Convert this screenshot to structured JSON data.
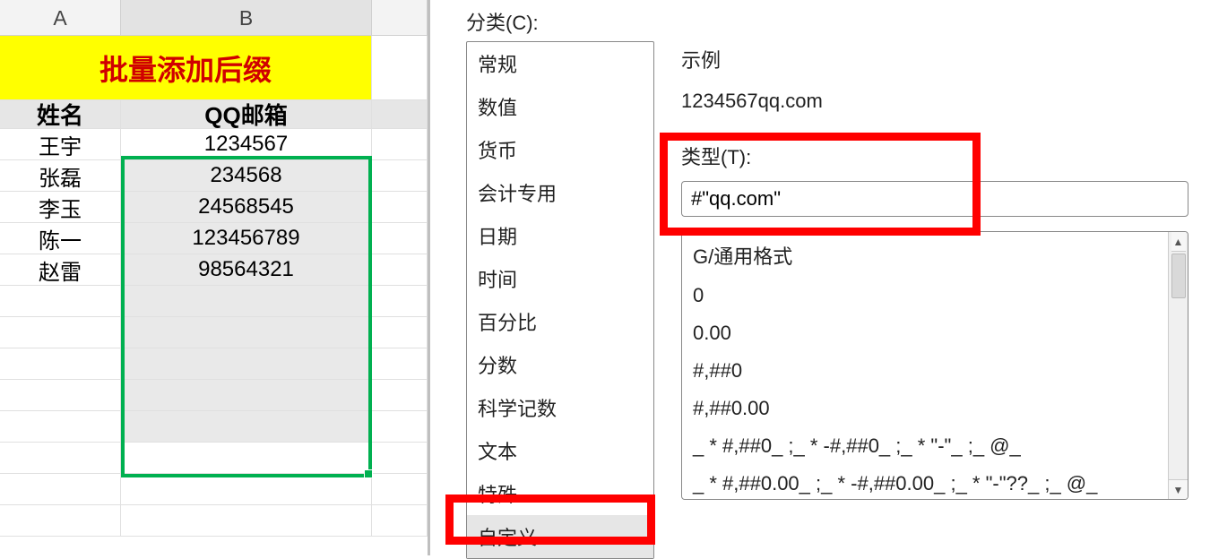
{
  "sheet": {
    "columns": {
      "A": "A",
      "B": "B"
    },
    "title": "批量添加后缀",
    "headers": {
      "name": "姓名",
      "email": "QQ邮箱"
    },
    "rows": [
      {
        "name": "王宇",
        "qq": "1234567"
      },
      {
        "name": "张磊",
        "qq": "234568"
      },
      {
        "name": "李玉",
        "qq": "24568545"
      },
      {
        "name": "陈一",
        "qq": "123456789"
      },
      {
        "name": "赵雷",
        "qq": "98564321"
      }
    ]
  },
  "dialog": {
    "category_label": "分类(C):",
    "categories": [
      "常规",
      "数值",
      "货币",
      "会计专用",
      "日期",
      "时间",
      "百分比",
      "分数",
      "科学记数",
      "文本",
      "特殊",
      "自定义"
    ],
    "selected_category_index": 11,
    "sample_label": "示例",
    "sample_value": "1234567qq.com",
    "type_label": "类型(T):",
    "type_value": "#\"qq.com\"",
    "format_presets": [
      "G/通用格式",
      "0",
      "0.00",
      "#,##0",
      "#,##0.00",
      "_ * #,##0_ ;_ * -#,##0_ ;_ * \"-\"_ ;_ @_",
      "_ * #,##0.00_ ;_ * -#,##0.00_ ;_ * \"-\"??_ ;_ @_"
    ]
  }
}
